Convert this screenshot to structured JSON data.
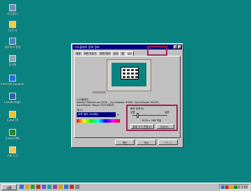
{
  "desktop_icons": [
    {
      "label": "내 컴퓨터",
      "color": "#6a8fbf"
    },
    {
      "label": "내 문서",
      "color": "#f2c94c"
    },
    {
      "label": "네트워크 환경",
      "color": "#4b7fc1"
    },
    {
      "label": "휴지통",
      "color": "#9aa4b2"
    },
    {
      "label": "Internet Explorer",
      "color": "#2f6fd6"
    },
    {
      "label": "LanVantage",
      "color": "#3a5f9f"
    },
    {
      "label": "CuteFTP",
      "color": "#e6c23a"
    },
    {
      "label": "CuteHTML",
      "color": "#2f7f2f"
    },
    {
      "label": "기록 도구",
      "color": "#f2c94c"
    }
  ],
  "dialog": {
    "title": "디스플레이 등록 정보",
    "title_buttons": [
      "?",
      "×"
    ],
    "tabs": [
      {
        "label": "배경"
      },
      {
        "label": "화면 보호기"
      },
      {
        "label": "화면 배색"
      },
      {
        "label": "효과"
      },
      {
        "label": "웹"
      },
      {
        "label": "설정"
      }
    ],
    "active_tab": "설정",
    "display_label": "디스플레이:",
    "display_value": "Matrox Millennium G200 _ SyncMaster 900SL (SyncMaster 900IFT, SyncMaster Magic CD700BXF)",
    "colors": {
      "title": "색(C)",
      "selected": "트루 컬러 (32비트)"
    },
    "resolution": {
      "title": "화면 영역(S)",
      "low": "낮음",
      "high": "높음",
      "value": "1024 x 768 픽셀",
      "level": 0.15,
      "buttons": [
        "글꼴 크기 변경(Z)",
        "고급(V)..."
      ]
    },
    "buttons": {
      "ok": "확인",
      "cancel": "취소",
      "apply": "적용(A)"
    }
  },
  "taskbar": {
    "start_label": "시작",
    "quicklaunch_colors": [
      "#2f6fd6",
      "#e0a020",
      "#2f9f2f",
      "#c03030",
      "#6060c0",
      "#20a0a0",
      "#a040a0",
      "#d0a000",
      "#2f6fd6",
      "#c03030",
      "#808080"
    ],
    "tray_colors": [
      "#2f6fd6",
      "#c03030",
      "#e0a020",
      "#2f9f2f"
    ],
    "clock": "오후 5:50"
  },
  "accent_colors": {
    "highlight_box": "#a0205a",
    "title_bar": "#000080",
    "desktop": "#0a8380"
  }
}
